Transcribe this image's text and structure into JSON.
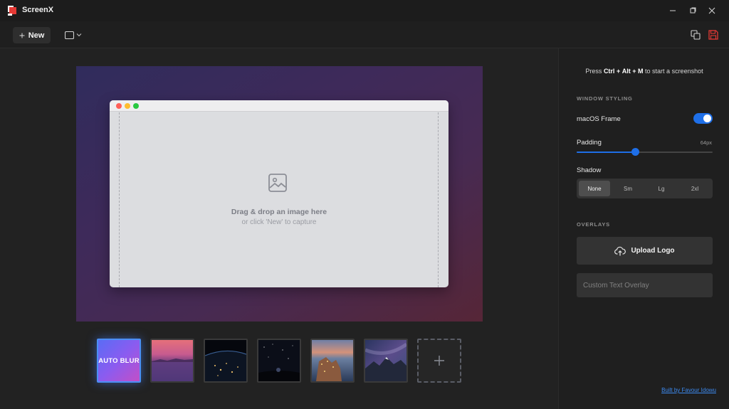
{
  "app": {
    "title": "ScreenX"
  },
  "toolbar": {
    "new_label": "New"
  },
  "canvas": {
    "drop_title": "Drag & drop an image here",
    "drop_subtitle": "or click 'New' to capture"
  },
  "backgrounds": {
    "auto_label": "AUTO BLUR",
    "items": [
      "sunset-lake",
      "earth-night",
      "starry-night",
      "cliff-town",
      "mountain-galaxy"
    ]
  },
  "sidebar": {
    "hint": {
      "prefix": "Press",
      "k1": "Ctrl",
      "k2": "Alt",
      "k3": "M",
      "plus": "+",
      "suffix": "to start a screenshot"
    },
    "window_styling_title": "WINDOW STYLING",
    "macos_frame_label": "macOS Frame",
    "macos_frame_enabled": true,
    "padding_label": "Padding",
    "padding_value": "64px",
    "padding_fraction": 0.43,
    "shadow_label": "Shadow",
    "shadow_options": [
      "None",
      "Sm",
      "Lg",
      "2xl"
    ],
    "shadow_selected": "None",
    "overlays_title": "OVERLAYS",
    "upload_logo_label": "Upload Logo",
    "text_overlay_placeholder": "Custom Text Overlay",
    "credit": "Built by Favour Idowu"
  },
  "colors": {
    "accent": "#1e6fe8",
    "link": "#3d8bf2"
  }
}
